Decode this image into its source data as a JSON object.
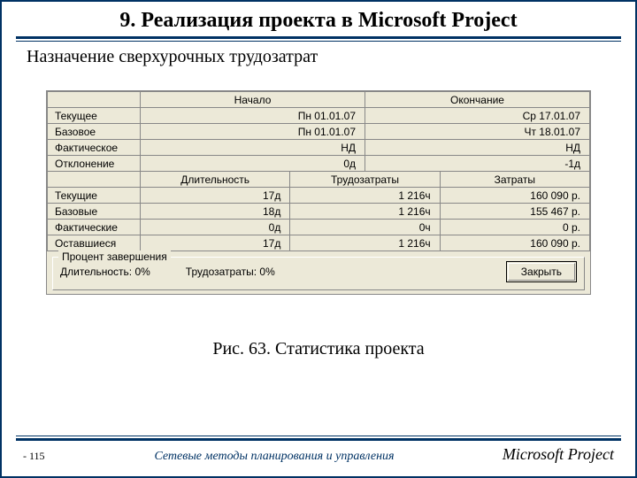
{
  "heading": "9. Реализация проекта в Microsoft Project",
  "subheading": "Назначение сверхурочных трудозатрат",
  "top": {
    "headers": {
      "start": "Начало",
      "end": "Окончание"
    },
    "rows": [
      {
        "label": "Текущее",
        "start": "Пн 01.01.07",
        "end": "Ср 17.01.07"
      },
      {
        "label": "Базовое",
        "start": "Пн 01.01.07",
        "end": "Чт 18.01.07"
      },
      {
        "label": "Фактическое",
        "start": "НД",
        "end": "НД"
      },
      {
        "label": "Отклонение",
        "start": "0д",
        "end": "-1д"
      }
    ]
  },
  "bottom": {
    "headers": {
      "dur": "Длительность",
      "work": "Трудозатраты",
      "cost": "Затраты"
    },
    "rows": [
      {
        "label": "Текущие",
        "dur": "17д",
        "work": "1 216ч",
        "cost": "160 090 р."
      },
      {
        "label": "Базовые",
        "dur": "18д",
        "work": "1 216ч",
        "cost": "155 467 р."
      },
      {
        "label": "Фактические",
        "dur": "0д",
        "work": "0ч",
        "cost": "0 р."
      },
      {
        "label": "Оставшиеся",
        "dur": "17д",
        "work": "1 216ч",
        "cost": "160 090 р."
      }
    ]
  },
  "percent": {
    "legend": "Процент завершения",
    "dur": "Длительность:  0%",
    "work": "Трудозатраты:  0%"
  },
  "close_label": "Закрыть",
  "caption": "Рис. 63. Статистика проекта",
  "footer": {
    "page": "- 115",
    "center": "Сетевые методы планирования и управления",
    "right": "Microsoft Project"
  }
}
